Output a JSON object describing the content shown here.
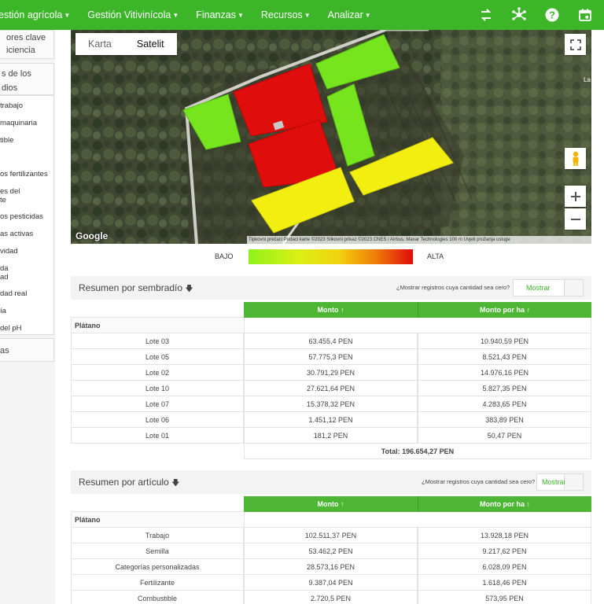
{
  "topnav": {
    "items": [
      {
        "label": "estión agrícola"
      },
      {
        "label": "Gestión Vitivinícola"
      },
      {
        "label": "Finanzas"
      },
      {
        "label": "Recursos"
      },
      {
        "label": "Analizar"
      }
    ],
    "icons": [
      "swap-icon",
      "network-icon",
      "help-icon",
      "calendar-icon"
    ]
  },
  "sidebar": {
    "block1": [
      "ores clave",
      "iciencia"
    ],
    "block2": [
      "s de los",
      "dios"
    ],
    "items": [
      "trabajo",
      "maquinaria",
      "tible",
      "os fertilizantes",
      "es del",
      "te",
      "os pesticidas",
      "as activas",
      "vidad",
      "da",
      "ad",
      "dad real",
      "ía",
      "del pH"
    ],
    "block3": "as"
  },
  "map": {
    "toggle_map": "Karta",
    "toggle_satellite": "Satelit",
    "google": "Google",
    "attribution": "Tipkovni prečaci   Podaci karte ©2023 Slikovni prikaz ©2023 CNES / Airbus, Maxar Technologies   100 m   Uvjeti pružanja usluge",
    "edge_label": "La"
  },
  "legend": {
    "low": "BAJO",
    "high": "ALTA"
  },
  "sections": [
    {
      "title": "Resumen por sembradío",
      "question": "¿Mostrar registros cuya cantidad sea cero?",
      "button": "Mostrar",
      "columns": [
        "Monto ↑",
        "Monto por ha ↑"
      ],
      "group": "Plátano",
      "rows": [
        {
          "name": "Lote 03",
          "monto": "63.455,4 PEN",
          "ha": "10.940,59 PEN"
        },
        {
          "name": "Lote 05",
          "monto": "57.775,3 PEN",
          "ha": "8.521,43 PEN"
        },
        {
          "name": "Lote 02",
          "monto": "30.791,29 PEN",
          "ha": "14.976,16 PEN"
        },
        {
          "name": "Lote 10",
          "monto": "27.621,64 PEN",
          "ha": "5.827,35 PEN"
        },
        {
          "name": "Lote 07",
          "monto": "15.378,32 PEN",
          "ha": "4.283,65 PEN"
        },
        {
          "name": "Lote 06",
          "monto": "1.451,12 PEN",
          "ha": "383,89 PEN"
        },
        {
          "name": "Lote 01",
          "monto": "181,2 PEN",
          "ha": "50,47 PEN"
        }
      ],
      "total": "Total: 196.654,27 PEN"
    },
    {
      "title": "Resumen por artículo",
      "question": "¿Mostrar registros cuya cantidad sea cero?",
      "button": "Mostrar",
      "columns": [
        "Monto ↑",
        "Monto por ha ↑"
      ],
      "group": "Plátano",
      "rows": [
        {
          "name": "Trabajo",
          "monto": "102.511,37 PEN",
          "ha": "13.928,18 PEN"
        },
        {
          "name": "Semilla",
          "monto": "53.462,2 PEN",
          "ha": "9.217,62 PEN"
        },
        {
          "name": "Categorías personalizadas",
          "monto": "28.573,16 PEN",
          "ha": "6.028,09 PEN"
        },
        {
          "name": "Fertilizante",
          "monto": "9.387,04 PEN",
          "ha": "1.618,46 PEN"
        },
        {
          "name": "Combustible",
          "monto": "2.720,5 PEN",
          "ha": "573,95 PEN"
        }
      ]
    }
  ],
  "colors": {
    "brand_green": "#3cb529",
    "plot_red": "#e00d0d",
    "plot_green": "#77e51e",
    "plot_yellow": "#f2ef10"
  }
}
